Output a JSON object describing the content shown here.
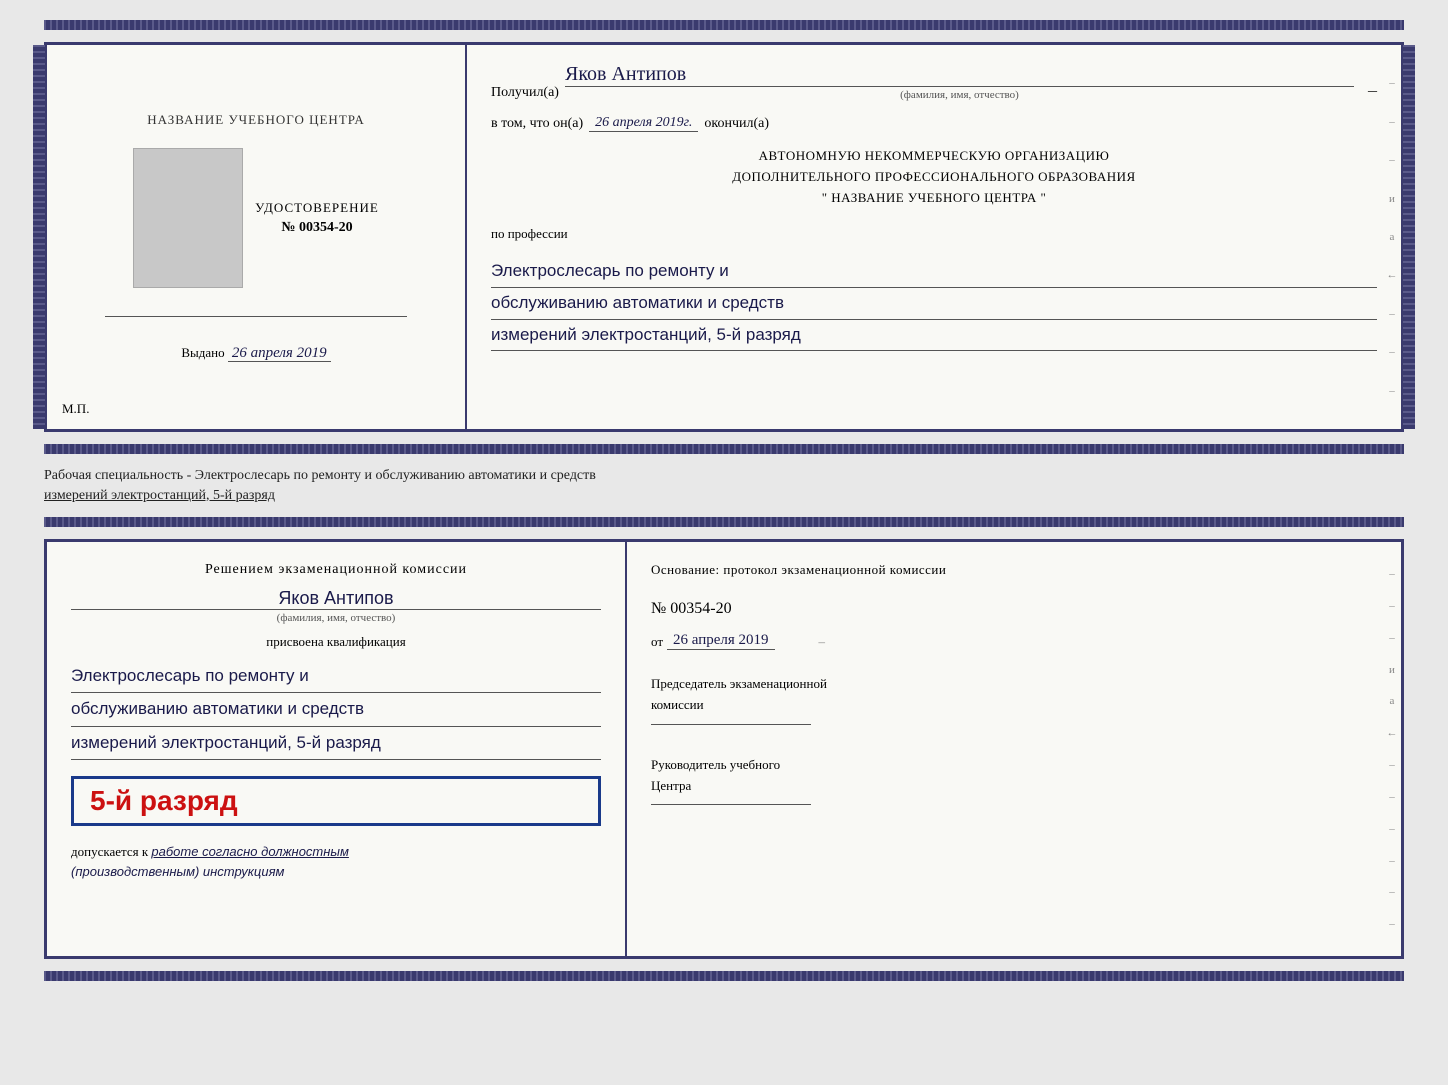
{
  "topDoc": {
    "leftTitle": "НАЗВАНИЕ УЧЕБНОГО ЦЕНТРА",
    "udostoverenie": "УДОСТОВЕРЕНИЕ",
    "number": "№ 00354-20",
    "vydano": "Выдано",
    "vydano_date": "26 апреля 2019",
    "mp": "М.П.",
    "poluchil": "Получил(а)",
    "name": "Яков Антипов",
    "fio_hint": "(фамилия, имя, отчество)",
    "vtom": "в том, что он(а)",
    "date_cursive": "26 апреля 2019г.",
    "okoncil": "окончил(а)",
    "org_line1": "АВТОНОМНУЮ НЕКОММЕРЧЕСКУЮ ОРГАНИЗАЦИЮ",
    "org_line2": "ДОПОЛНИТЕЛЬНОГО ПРОФЕССИОНАЛЬНОГО ОБРАЗОВАНИЯ",
    "org_name": "\" НАЗВАНИЕ УЧЕБНОГО ЦЕНТРА \"",
    "po_professii": "по профессии",
    "profession_line1": "Электрослесарь по ремонту и",
    "profession_line2": "обслуживанию автоматики и средств",
    "profession_line3": "измерений электростанций, 5-й разряд"
  },
  "middleText": {
    "line1": "Рабочая специальность - Электрослесарь по ремонту и обслуживанию автоматики и средств",
    "line2": "измерений электростанций, 5-й разряд"
  },
  "botDoc": {
    "resheniem": "Решением экзаменационной комиссии",
    "name": "Яков Антипов",
    "fio_hint": "(фамилия, имя, отчество)",
    "prisvoena": "присвоена квалификация",
    "prof_line1": "Электрослесарь по ремонту и",
    "prof_line2": "обслуживанию автоматики и средств",
    "prof_line3": "измерений электростанций, 5-й разряд",
    "razryad_badge": "5-й разряд",
    "dopuskaetsya": "допускается к",
    "dopusk_italic": "работе согласно должностным",
    "dopusk_italic2": "(производственным) инструкциям",
    "osnov": "Основание: протокол экзаменационной комиссии",
    "num": "№  00354-20",
    "ot_label": "от",
    "ot_date": "26 апреля 2019",
    "predsedatel_title": "Председатель экзаменационной",
    "predsedatel_sub": "комиссии",
    "rukovoditel_title": "Руководитель учебного",
    "rukovoditel_sub": "Центра"
  },
  "dashes": [
    "-",
    "-",
    "-",
    "и",
    "а",
    "←",
    "-",
    "-",
    "-",
    "-",
    "-",
    "-"
  ]
}
